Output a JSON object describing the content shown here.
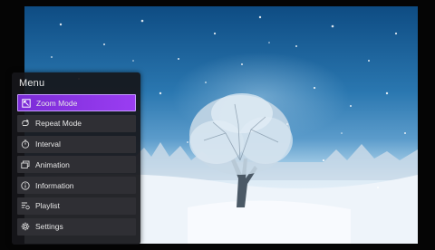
{
  "menu": {
    "title": "Menu",
    "items": [
      {
        "label": "Zoom Mode",
        "icon": "zoom-mode-icon",
        "selected": true
      },
      {
        "label": "Repeat Mode",
        "icon": "repeat-icon",
        "selected": false
      },
      {
        "label": "Interval",
        "icon": "timer-icon",
        "selected": false
      },
      {
        "label": "Animation",
        "icon": "animation-icon",
        "selected": false
      },
      {
        "label": "Information",
        "icon": "info-icon",
        "selected": false
      },
      {
        "label": "Playlist",
        "icon": "playlist-icon",
        "selected": false
      },
      {
        "label": "Settings",
        "icon": "gear-icon",
        "selected": false
      }
    ]
  },
  "colors": {
    "menu_bg": "#16161a",
    "item_bg": "#2f2f34",
    "accent": "#8a35e6",
    "text": "#e6e6e6"
  }
}
